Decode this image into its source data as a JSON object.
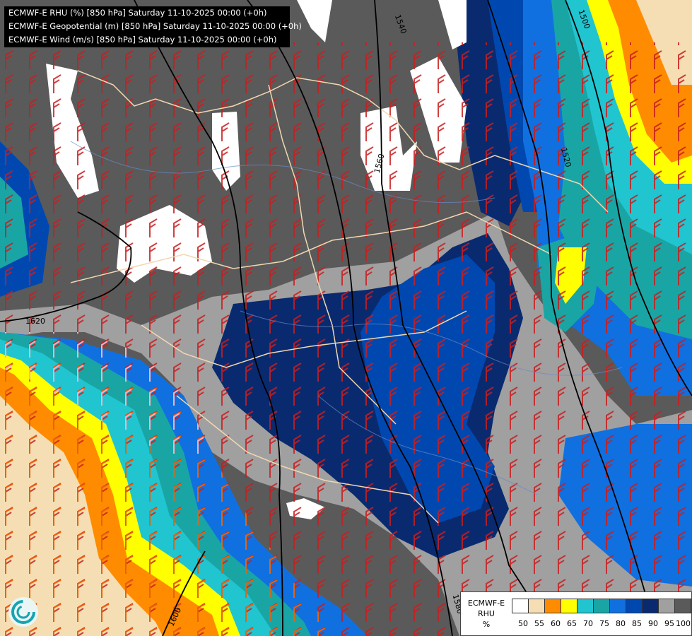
{
  "header": {
    "lines": [
      "ECMWF-E RHU (%) [850 hPa] Saturday 11-10-2025 00:00 (+0h)",
      "ECMWF-E Geopotential (m) [850 hPa] Saturday 11-10-2025 00:00 (+0h)",
      "ECMWF-E Wind (m/s) [850 hPa] Saturday 11-10-2025 00:00 (+0h)"
    ]
  },
  "contour_labels": [
    "1540",
    "1560",
    "1500",
    "1520",
    "1620",
    "1600",
    "1580"
  ],
  "legend": {
    "title_line1": "ECMWF-E",
    "title_line2": "RHU",
    "unit": "%",
    "levels": [
      "50",
      "55",
      "60",
      "65",
      "70",
      "75",
      "80",
      "85",
      "90",
      "95",
      "100"
    ],
    "colors": [
      "#ffffff",
      "#f5deb3",
      "#ff8c00",
      "#ffff00",
      "#20c5d0",
      "#1aa5a5",
      "#1070e0",
      "#0048b0",
      "#0a2a70",
      "#a0a0a0",
      "#5a5a5a"
    ]
  },
  "logo": {
    "icon": "ecmwf-logo-icon"
  }
}
